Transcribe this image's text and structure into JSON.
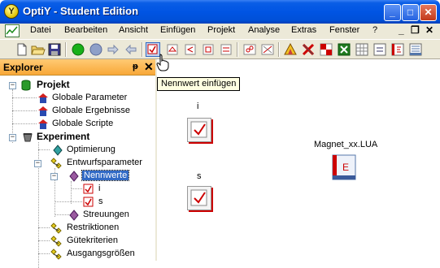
{
  "window": {
    "title": "OptiY - Student Edition",
    "app_icon_letter": "Y"
  },
  "window_buttons": {
    "minimize": "_",
    "maximize": "□",
    "close": "✕"
  },
  "menu": [
    "Datei",
    "Bearbeiten",
    "Ansicht",
    "Einfügen",
    "Projekt",
    "Analyse",
    "Extras",
    "Fenster",
    "?"
  ],
  "menu_controls": {
    "minimize": "_",
    "restore": "❐",
    "close": "✕"
  },
  "toolbar": {
    "icons": [
      "new-document-icon",
      "open-folder-icon",
      "save-icon",
      "run-icon",
      "stop-icon",
      "step-forward-icon",
      "step-back-icon",
      "insert-nominal-value-icon",
      "insert-constraint-icon",
      "insert-criterion-icon",
      "insert-output-icon",
      "insert-chain-icon",
      "insert-scatter-icon",
      "insert-histogram-icon",
      "insert-triangle-icon",
      "insert-cross-icon",
      "insert-split-icon",
      "insert-excel-icon",
      "insert-matrix-icon",
      "insert-ncom-icon",
      "insert-script-icon",
      "insert-sheet-icon"
    ],
    "tooltip": "Nennwert einfügen"
  },
  "explorer": {
    "title": "Explorer",
    "pin": "ᵽ",
    "close": "✕",
    "tree": [
      {
        "label": "Projekt",
        "bold": true
      },
      {
        "label": "Globale Parameter"
      },
      {
        "label": "Globale Ergebnisse"
      },
      {
        "label": "Globale Scripte"
      },
      {
        "label": "Experiment",
        "bold": true
      },
      {
        "label": "Optimierung"
      },
      {
        "label": "Entwurfsparameter"
      },
      {
        "label": "Nennwerte",
        "selected": true
      },
      {
        "label": "i"
      },
      {
        "label": "s"
      },
      {
        "label": "Streuungen"
      },
      {
        "label": "Restriktionen"
      },
      {
        "label": "Gütekriterien"
      },
      {
        "label": "Ausgangsgrößen"
      }
    ]
  },
  "canvas": {
    "blocks": [
      {
        "label": "i"
      },
      {
        "label": "s"
      }
    ],
    "script_block": {
      "label": "Magnet_xx.LUA",
      "glyph": "E"
    }
  },
  "colors": {
    "title_bar": "#0054e3",
    "explorer_header": "#f8a838",
    "selection": "#316ac5",
    "tooltip_bg": "#ffffe1"
  }
}
